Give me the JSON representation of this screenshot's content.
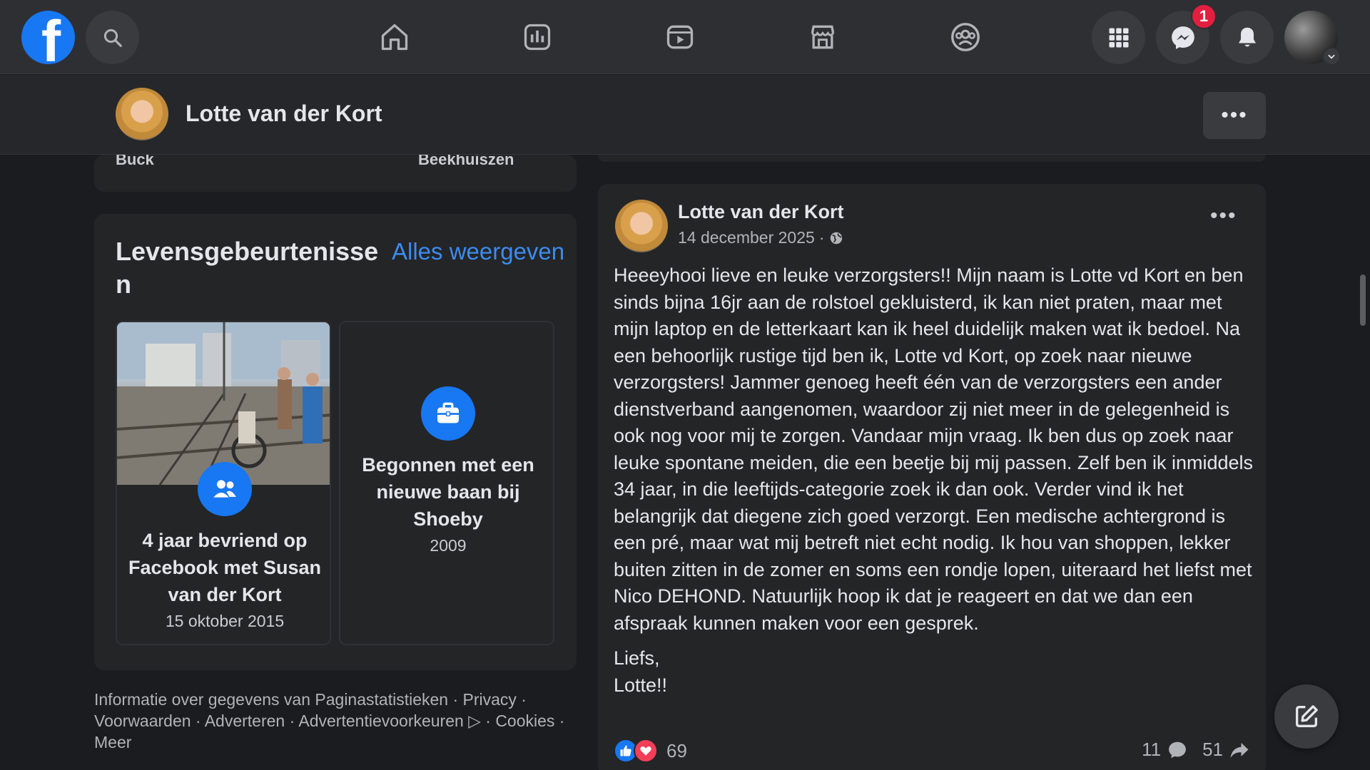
{
  "topnav": {
    "logo_letter": "f",
    "notification_badge": "1",
    "icons": [
      "facebook-logo",
      "search-icon",
      "home-icon",
      "feeds-icon",
      "video-icon",
      "marketplace-icon",
      "groups-icon",
      "menu-grid-icon",
      "messenger-icon",
      "bell-icon",
      "account-avatar"
    ]
  },
  "profile_bar": {
    "name": "Lotte van der Kort",
    "more_label": "•••"
  },
  "previous_card": {
    "left_text": "Buck",
    "right_text": "Beekhuiszen"
  },
  "life_events": {
    "title": "Levensgebeurtenissen",
    "see_all": "Alles weergeven",
    "items": [
      {
        "text": "4 jaar bevriend op Facebook met Susan van der Kort",
        "date": "15 oktober 2015",
        "icon": "friends-icon"
      },
      {
        "text": "Begonnen met een nieuwe baan bij Shoeby",
        "date": "2009",
        "icon": "briefcase-icon"
      }
    ]
  },
  "footer": {
    "text": "Informatie over gegevens van Paginastatistieken · Privacy · Voorwaarden · Adverteren · Advertentievoorkeuren ▷ · Cookies · Meer"
  },
  "post": {
    "author": "Lotte van der Kort",
    "date": "14 december 2025",
    "separator": "·",
    "more_label": "•••",
    "body": "Heeeyhooi lieve en leuke verzorgsters!! Mijn naam is Lotte vd Kort en ben sinds bijna 16jr aan de rolstoel gekluisterd, ik kan niet praten, maar met mijn laptop en de letterkaart kan ik heel duidelijk maken wat ik bedoel. Na een behoorlijk rustige tijd ben ik, Lotte vd Kort, op zoek naar nieuwe verzorgsters! Jammer genoeg heeft één van de verzorgsters een ander dienstverband aangenomen, waardoor zij niet meer in de gelegenheid is ook nog voor mij te zorgen. Vandaar mijn vraag. Ik ben dus op zoek naar leuke spontane meiden, die een beetje bij mij passen. Zelf ben ik inmiddels 34 jaar, in die leeftijds-categorie zoek ik dan ook. Verder vind ik het belangrijk dat diegene zich goed verzorgt. Een medische achtergrond is een pré, maar wat mij betreft niet echt nodig. Ik hou van shoppen, lekker buiten zitten in de zomer en soms een rondje lopen, uiteraard het liefst met Nico DEHOND. Natuurlijk hoop ik dat je reageert en dat we dan een afspraak kunnen maken voor een gesprek.",
    "signoff_1": "Liefs,",
    "signoff_2": "Lotte!!",
    "reaction_count": "69",
    "comment_count": "11",
    "share_count": "51"
  },
  "colors": {
    "accent": "#1877f2",
    "link": "#3b8cf0",
    "badge": "#e41e3f",
    "love": "#f33e58",
    "background": "#1b1c1f",
    "card": "#242527"
  }
}
